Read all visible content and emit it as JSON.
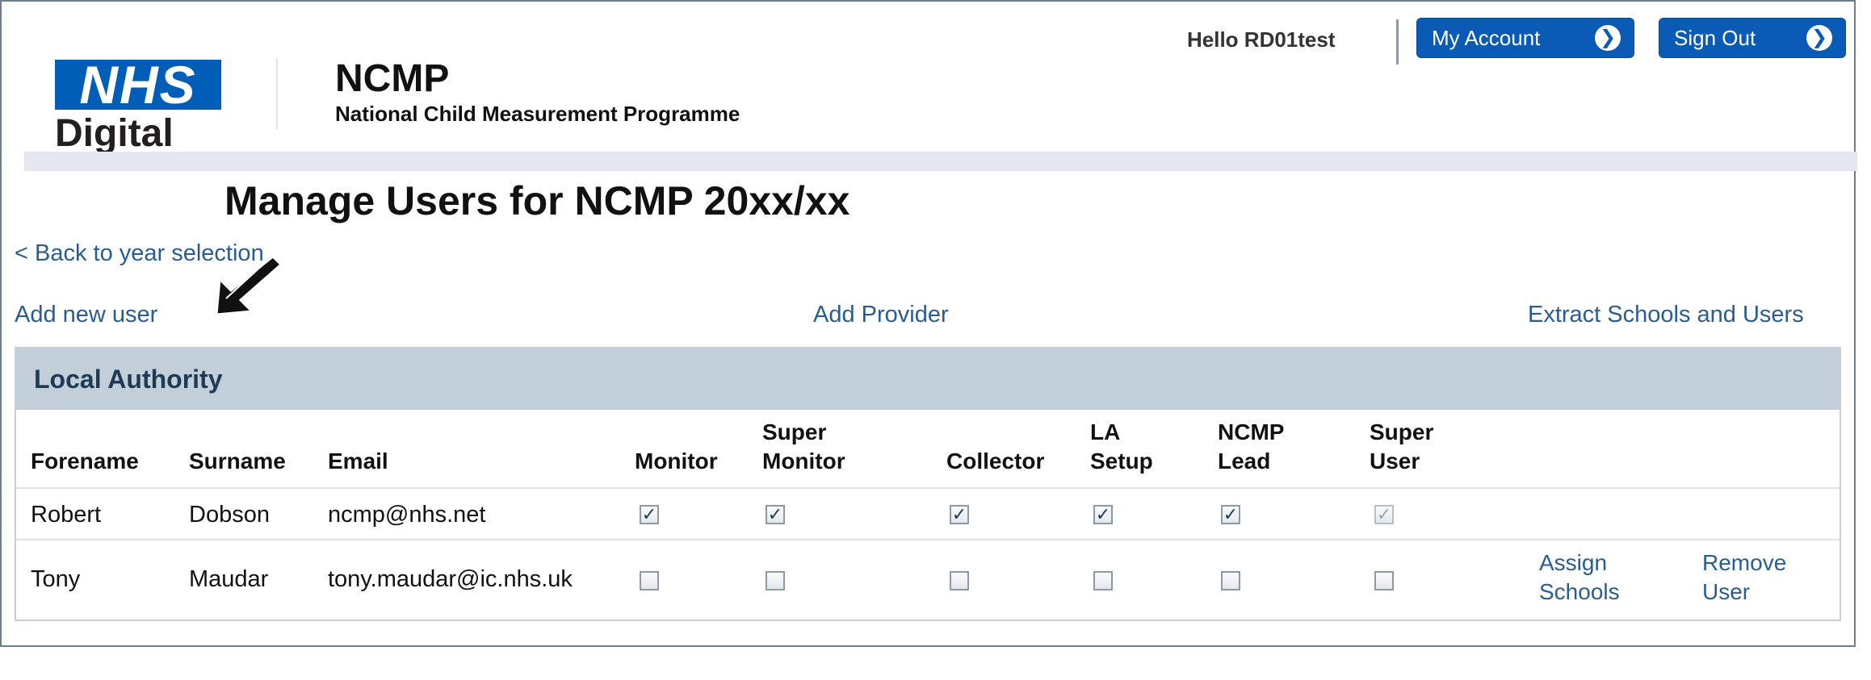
{
  "header": {
    "logo_nhs": "NHS",
    "logo_digital": "Digital",
    "app_title": "NCMP",
    "app_subtitle": "National Child Measurement Programme",
    "greeting": "Hello RD01test",
    "my_account_label": "My Account",
    "sign_out_label": "Sign Out",
    "chevron_glyph": "❯"
  },
  "page": {
    "title": "Manage Users for NCMP 20xx/xx",
    "back_link": "< Back to year selection",
    "add_user_link": "Add new user",
    "add_provider_link": "Add Provider",
    "extract_link": "Extract Schools and Users"
  },
  "panel": {
    "heading": "Local Authority",
    "columns": {
      "forename": "Forename",
      "surname": "Surname",
      "email": "Email",
      "monitor": "Monitor",
      "super_monitor_1": "Super",
      "super_monitor_2": "Monitor",
      "collector": "Collector",
      "la_setup_1": "LA",
      "la_setup_2": "Setup",
      "ncmp_lead_1": "NCMP",
      "ncmp_lead_2": "Lead",
      "super_user_1": "Super",
      "super_user_2": "User"
    },
    "rows": [
      {
        "forename": "Robert",
        "surname": "Dobson",
        "email": "ncmp@nhs.net",
        "monitor": "✓",
        "super_monitor": "✓",
        "collector": "✓",
        "la_setup": "✓",
        "ncmp_lead": "✓",
        "super_user": "✓"
      },
      {
        "forename": "Tony",
        "surname": "Maudar",
        "email": "tony.maudar@ic.nhs.uk",
        "monitor": "",
        "super_monitor": "",
        "collector": "",
        "la_setup": "",
        "ncmp_lead": "",
        "super_user": "",
        "assign_1": "Assign",
        "assign_2": "Schools",
        "remove_1": "Remove",
        "remove_2": "User"
      }
    ]
  },
  "colors": {
    "nhs_blue": "#005eb8",
    "button_blue": "#0a5bb6",
    "link_blue": "#2a5d8f",
    "panel_header": "#c3cfd8"
  }
}
